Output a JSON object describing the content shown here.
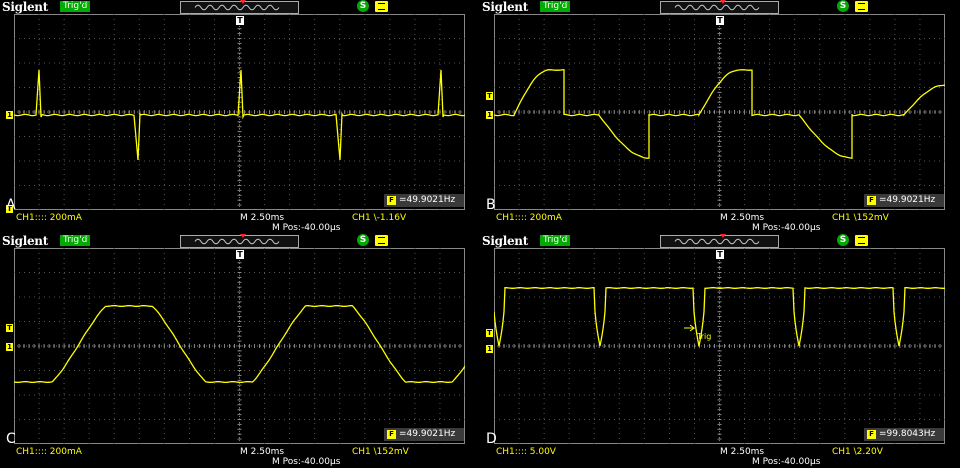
{
  "colors": {
    "trace": "#ffff00",
    "grid": "#808080",
    "background": "#000000",
    "trig_badge": "#00aa00"
  },
  "panels": [
    {
      "brand": "Siglent",
      "trig": "Trig'd",
      "label": "A",
      "freq": "=49.9021Hz",
      "ch": "CH1:::: 200mA",
      "timebase": "M 2.50ms",
      "trigger": "CH1 \\-1.16V",
      "mpos": "M Pos:-40.00μs",
      "markers": [
        "1",
        "T"
      ],
      "icons": [
        "trigger-mode-icon",
        "sync-icon",
        "print-icon"
      ]
    },
    {
      "brand": "Siglent",
      "trig": "Trig'd",
      "label": "B",
      "freq": "=49.9021Hz",
      "ch": "CH1:::: 200mA",
      "timebase": "M 2.50ms",
      "trigger": "CH1 \\152mV",
      "mpos": "M Pos:-40.00μs",
      "markers": [
        "T",
        "1"
      ]
    },
    {
      "brand": "Siglent",
      "trig": "Trig'd",
      "label": "C",
      "freq": "=49.9021Hz",
      "ch": "CH1:::: 200mA",
      "timebase": "M 2.50ms",
      "trigger": "CH1 \\152mV",
      "mpos": "M Pos:-40.00μs",
      "markers": [
        "T",
        "1"
      ]
    },
    {
      "brand": "Siglent",
      "trig": "Trig'd",
      "label": "D",
      "freq": "=99.8043Hz",
      "ch": "CH1:::: 5.00V",
      "timebase": "M 2.50ms",
      "trigger": "CH1 \\2.20V",
      "mpos": "M Pos:-40.00μs",
      "markers": [
        "T",
        "1"
      ],
      "trig_label": "Trig"
    }
  ]
}
